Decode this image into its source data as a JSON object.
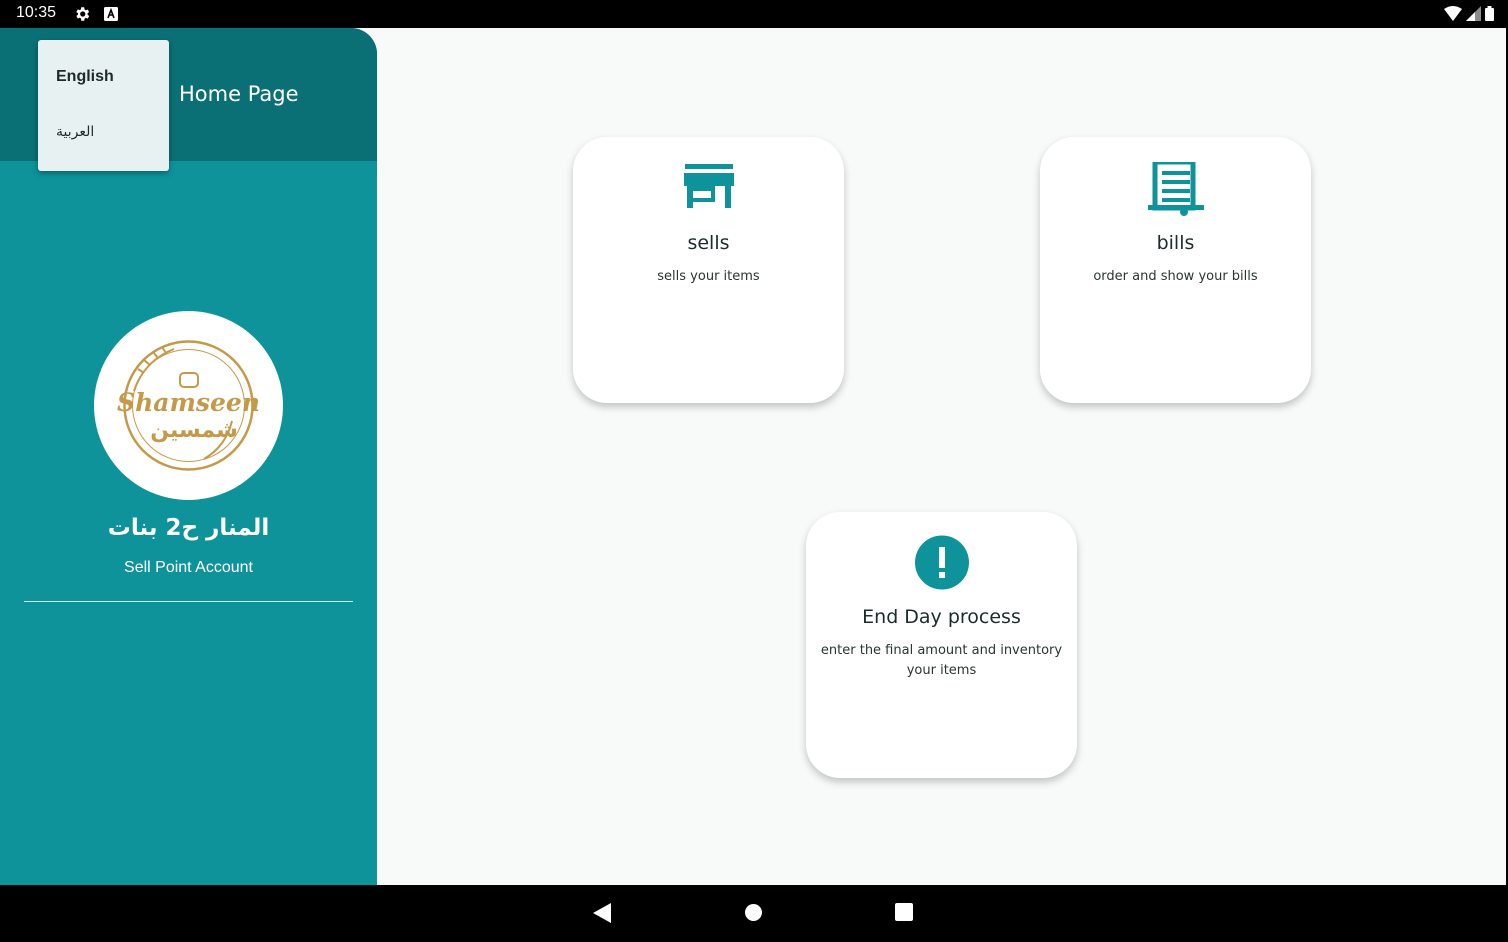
{
  "status_bar": {
    "time": "10:35",
    "icons": [
      "gear-icon",
      "keyboard-a-icon",
      "wifi-icon",
      "signal-icon",
      "battery-icon"
    ]
  },
  "drawer": {
    "title": "Home Page",
    "language_menu": {
      "items": [
        {
          "label": "English",
          "selected": true
        },
        {
          "label": "العربية",
          "selected": false
        }
      ]
    },
    "logo": {
      "text": "Shamseen",
      "text_ar": "شمسين"
    },
    "account_name": "المنار ح2 بنات",
    "account_type": "Sell Point Account"
  },
  "cards": {
    "sells": {
      "icon": "store-icon",
      "title": "sells",
      "description": "sells your items"
    },
    "bills": {
      "icon": "receipt-icon",
      "title": "bills",
      "description": "order and show your bills"
    },
    "end_day": {
      "icon": "alert-icon",
      "title": "End Day process",
      "description": "enter the final amount and inventory your items"
    }
  },
  "nav_bar": {
    "buttons": [
      "back-icon",
      "home-icon",
      "recents-icon"
    ]
  },
  "colors": {
    "accent": "#0e939b",
    "header": "#0b7075",
    "logo_gold": "#c49a4a"
  }
}
